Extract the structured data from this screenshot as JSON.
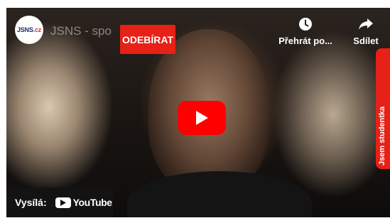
{
  "channel": {
    "logo_text": "JSNS",
    "logo_accent": ".cz",
    "title": "JSNS - spo",
    "subscribe_label": "ODEBÍRAT"
  },
  "actions": {
    "watch_later": {
      "label": "Přehrát po...",
      "icon": "clock-icon"
    },
    "share": {
      "label": "Sdílet",
      "icon": "share-arrow-icon"
    }
  },
  "player": {
    "play_icon": "play-icon"
  },
  "side_tab": {
    "label": "Jsem studentka"
  },
  "footer": {
    "watch_on_label": "Vysílá:",
    "platform": "YouTube"
  },
  "colors": {
    "accent_red": "#e62117",
    "play_red": "#ff0000"
  }
}
